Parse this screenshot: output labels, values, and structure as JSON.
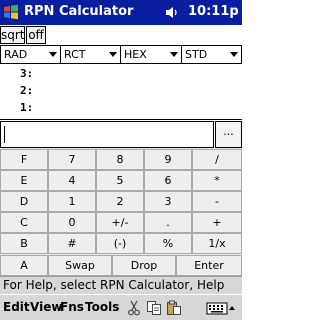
{
  "titlebar": {
    "app_title": "RPN Calculator",
    "time": "10:11p"
  },
  "mode_buttons": [
    "sqrt",
    "off"
  ],
  "selects": {
    "angle": "RAD",
    "coords": "RCT",
    "base": "HEX",
    "format": "STD"
  },
  "stack": [
    {
      "label": "3:",
      "value": ""
    },
    {
      "label": "2:",
      "value": ""
    },
    {
      "label": "1:",
      "value": ""
    }
  ],
  "entry": {
    "value": "",
    "more_label": "..."
  },
  "keypad": {
    "rows": [
      [
        "F",
        "7",
        "8",
        "9",
        "/"
      ],
      [
        "E",
        "4",
        "5",
        "6",
        "*"
      ],
      [
        "D",
        "1",
        "2",
        "3",
        "-"
      ],
      [
        "C",
        "0",
        "+/-",
        ".",
        "+"
      ],
      [
        "B",
        "#",
        "(-)",
        "%",
        "1/x"
      ],
      [
        "A",
        "Swap",
        "Drop",
        "Enter"
      ]
    ]
  },
  "hint": "For Help, select RPN Calculator, Help",
  "menubar": {
    "items": [
      "Edit",
      "View",
      "Fns",
      "Tools"
    ]
  },
  "colors": {
    "titlebar_bg": "#0a1fa0",
    "keypad_bg": "#e8e8e8",
    "key_face": "#eeeeee",
    "menubar_bg": "#d7d7d7"
  },
  "icons": [
    "windows-start-icon",
    "speaker-icon",
    "cut-icon",
    "copy-icon",
    "paste-icon",
    "keyboard-icon"
  ]
}
